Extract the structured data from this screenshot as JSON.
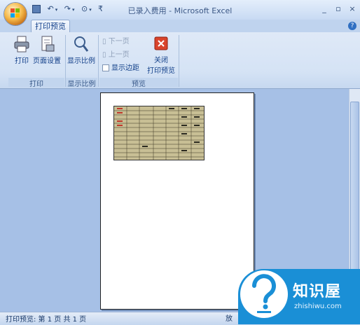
{
  "window": {
    "title": "已录入费用 - Microsoft Excel",
    "minimize": "_",
    "restore": "▫",
    "close": "×"
  },
  "tabs": [
    {
      "label": "打印预览",
      "active": true
    }
  ],
  "help_glyph": "?",
  "ribbon": {
    "groups": [
      {
        "label": "打印",
        "buttons": [
          {
            "label": "打印",
            "icon": "printer-icon"
          },
          {
            "label": "页面设置",
            "icon": "page-setup-icon"
          }
        ]
      },
      {
        "label": "显示比例",
        "buttons": [
          {
            "label": "显示比例",
            "icon": "zoom-icon"
          }
        ]
      },
      {
        "label": "预览",
        "small_buttons": [
          {
            "label": "下一页",
            "enabled": false
          },
          {
            "label": "上一页",
            "enabled": false
          }
        ],
        "checkbox": {
          "label": "显示边距",
          "checked": false
        },
        "buttons": [
          {
            "label_line1": "关闭",
            "label_line2": "打印预览",
            "icon": "close-preview-icon"
          }
        ]
      }
    ]
  },
  "statusbar": {
    "text": "打印预览: 第 1 页 共 1 页",
    "zoom_label": "放"
  },
  "watermark": {
    "title": "知识屋",
    "url": "zhishiwu.com"
  },
  "colors": {
    "accent": "#15428b",
    "ribbon": "#dfe9f7",
    "workspace": "#a6c0e6",
    "watermark": "#1a8fd6"
  }
}
